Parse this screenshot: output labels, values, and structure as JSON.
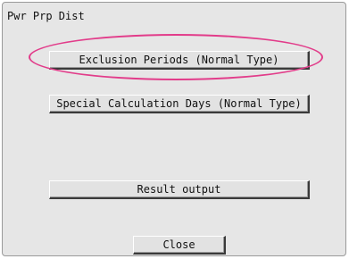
{
  "window": {
    "title": "Pwr Prp Dist"
  },
  "buttons": {
    "exclusion_periods": "Exclusion Periods (Normal Type)",
    "special_calculation_days": "Special Calculation Days (Normal Type)",
    "result_output": "Result output",
    "close": "Close"
  },
  "colors": {
    "highlight": "#e23c8a",
    "panel_background": "#e6e6e6"
  }
}
